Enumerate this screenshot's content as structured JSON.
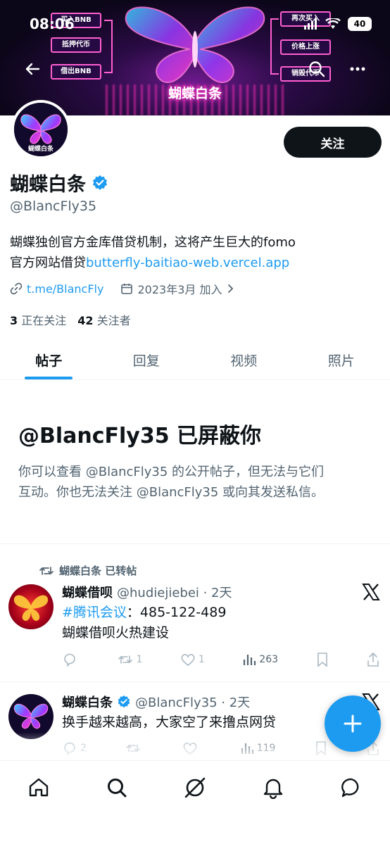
{
  "status_bar": {
    "time": "08:06",
    "battery": "40"
  },
  "banner": {
    "title": "蝴蝶白条",
    "left_boxes": [
      "买入BNB",
      "抵押代币",
      "借出BNB"
    ],
    "right_boxes": [
      "再次买入",
      "价格上涨",
      "销毁代币"
    ]
  },
  "profile": {
    "avatar_text": "蝴蝶白条",
    "follow_label": "关注",
    "display_name": "蝴蝶白条",
    "handle": "@BlancFly35",
    "bio_line1": "蝴蝶独创官方金库借贷机制，这将产生巨大的fomo",
    "bio_line2_prefix": "官方网站借贷",
    "bio_link": "butterfly-baitiao-web.vercel.app",
    "website": "t.me/BlancFly",
    "joined": "2023年3月 加入",
    "following_count": "3",
    "following_label": "正在关注",
    "followers_count": "42",
    "followers_label": "关注者"
  },
  "tabs": [
    {
      "label": "帖子"
    },
    {
      "label": "回复"
    },
    {
      "label": "视频"
    },
    {
      "label": "照片"
    }
  ],
  "blocked": {
    "title": "@BlancFly35 已屏蔽你",
    "desc_line1": "你可以查看 @BlancFly35 的公开帖子，但无法与它们",
    "desc_line2": "互动。你也无法关注 @BlancFly35 或向其发送私信。"
  },
  "posts": [
    {
      "repost_label": "蝴蝶白条 已转帖",
      "name": "蝴蝶借呗",
      "meta": "@hudiejiebei · 2天",
      "tag": "#腾讯会议",
      "text_line1_rest": "：485-122-489",
      "text_line2": "蝴蝶借呗火热建设",
      "replies": "",
      "reposts": "1",
      "likes": "1",
      "views": "263"
    },
    {
      "name": "蝴蝶白条",
      "meta": "@BlancFly35 · 2天",
      "text_line1": "换手越来越高，大家空了来撸点网贷",
      "replies": "2",
      "reposts": "",
      "likes": "",
      "views": "119"
    }
  ]
}
